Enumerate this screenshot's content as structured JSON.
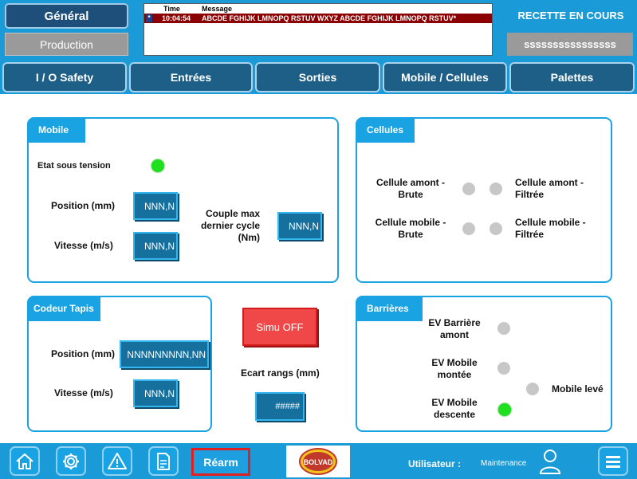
{
  "header": {
    "general_label": "Général",
    "production_label": "Production",
    "recipe_title": "RECETTE EN COURS",
    "recipe_value": "ssssssssssssssss"
  },
  "messages": {
    "col_time": "Time",
    "col_message": "Message",
    "rows": [
      {
        "marker": "*",
        "time": "10:04:54",
        "text": "ABCDE FGHIJK LMNOPQ RSTUV WXYZ ABCDE FGHIJK LMNOPQ RSTUV*"
      }
    ]
  },
  "tabs": [
    {
      "label": "I / O Safety"
    },
    {
      "label": "Entrées"
    },
    {
      "label": "Sorties"
    },
    {
      "label": "Mobile / Cellules"
    },
    {
      "label": "Palettes"
    }
  ],
  "mobile": {
    "title": "Mobile",
    "etat_label": "Etat sous tension",
    "position_label": "Position (mm)",
    "position_value": "NNN,N",
    "vitesse_label": "Vitesse (m/s)",
    "vitesse_value": "NNN,N",
    "couple_label": "Couple max dernier cycle (Nm)",
    "couple_value": "NNN,N"
  },
  "cellules": {
    "title": "Cellules",
    "amont_brute": "Cellule amont - Brute",
    "amont_filtree": "Cellule amont - Filtrée",
    "mobile_brute": "Cellule mobile - Brute",
    "mobile_filtree": "Cellule mobile - Filtrée"
  },
  "codeur": {
    "title": "Codeur Tapis",
    "position_label": "Position (mm)",
    "position_value": "NNNNNNNNN,NN",
    "vitesse_label": "Vitesse (m/s)",
    "vitesse_value": "NNN,N"
  },
  "controls": {
    "simu_label": "Simu OFF",
    "ecart_label": "Ecart rangs (mm)",
    "ecart_value": "#####"
  },
  "barrieres": {
    "title": "Barrières",
    "ev_amont": "EV Barrière amont",
    "ev_montee": "EV Mobile montée",
    "ev_descente": "EV Mobile descente",
    "mobile_leve": "Mobile levé"
  },
  "footer": {
    "rearm_label": "Réarm",
    "user_label": "Utilisateur :",
    "user_value": "Maintenance",
    "logo_text": "BOLVAD"
  },
  "colors": {
    "accent": "#1a9bd7",
    "led_on": "#1ee01e",
    "led_off": "#c7c7c7",
    "alarm_row": "#8b0000",
    "simu_off": "#f04848"
  }
}
